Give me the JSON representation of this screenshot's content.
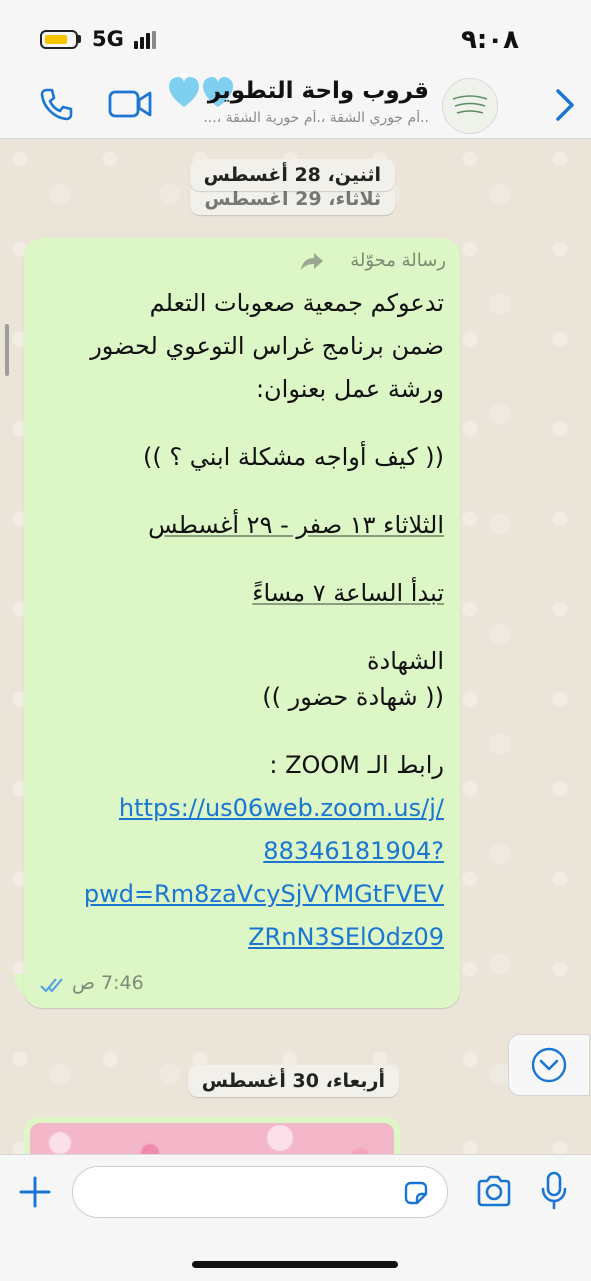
{
  "status_bar": {
    "network": "5G",
    "time": "٩:٠٨"
  },
  "header": {
    "group_name": "قروب واحة التطوير",
    "members": "..أم جوري الشقة ،.أم حورية الشقة ،...",
    "avatar_icon": "group-avatar",
    "hearts_color": "#7fd0f0",
    "accent_color": "#1a76d2"
  },
  "chat": {
    "date_top": "اثنين، 28 أغسطس",
    "date_under": "ثلاثاء، 29 أغسطس",
    "message": {
      "forwarded_label": "رسالة محوّلة",
      "lines": [
        "تدعوكم جمعية  صعوبات التعلم",
        "ضمن برنامج غراس التوعوي لحضور",
        "ورشة عمل بعنوان:",
        "",
        "(( كيف أواجه مشكلة ابني ؟ ))",
        "",
        " الثلاثاء ١٣ صفر - ٢٩ أغسطس",
        "",
        "تبدأ الساعة ٧ مساءً",
        "",
        "الشهادة",
        "  (( شهادة حضور ))",
        "",
        "رابط الـ ZOOM :"
      ],
      "link_lines": [
        "https://us06web.zoom.us/j/",
        "88346181904?",
        "pwd=Rm8zaVcySjVYMGtFVEV",
        "ZRnN3SElOdz09"
      ],
      "time": "7:46 ص",
      "status_icon": "double-check-icon"
    },
    "date_bottom": "أربعاء، 30 أغسطس",
    "bubble_color": "#dcf7c5"
  },
  "input_bar": {
    "placeholder": ""
  }
}
